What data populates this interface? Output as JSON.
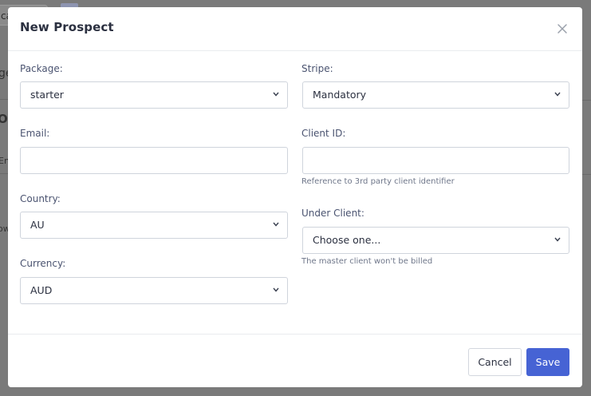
{
  "background": {
    "input_fragment": "ca",
    "frag_ge": "ge",
    "frag_o": "O",
    "frag_en": "En",
    "frag_ow": "ow"
  },
  "modal": {
    "title": "New Prospect",
    "close_icon": "close-icon",
    "fields": {
      "package": {
        "label": "Package:",
        "value": "starter"
      },
      "stripe": {
        "label": "Stripe:",
        "value": "Mandatory"
      },
      "email": {
        "label": "Email:",
        "value": "",
        "placeholder": ""
      },
      "client_id": {
        "label": "Client ID:",
        "value": "",
        "placeholder": "",
        "help": "Reference to 3rd party client identifier"
      },
      "country": {
        "label": "Country:",
        "value": "AU"
      },
      "under_client": {
        "label": "Under Client:",
        "value": "Choose one...",
        "help": "The master client won't be billed"
      },
      "currency": {
        "label": "Currency:",
        "value": "AUD"
      }
    },
    "footer": {
      "cancel_label": "Cancel",
      "save_label": "Save"
    }
  },
  "colors": {
    "primary": "#4663d4",
    "overlay": "#7a7a7a"
  }
}
